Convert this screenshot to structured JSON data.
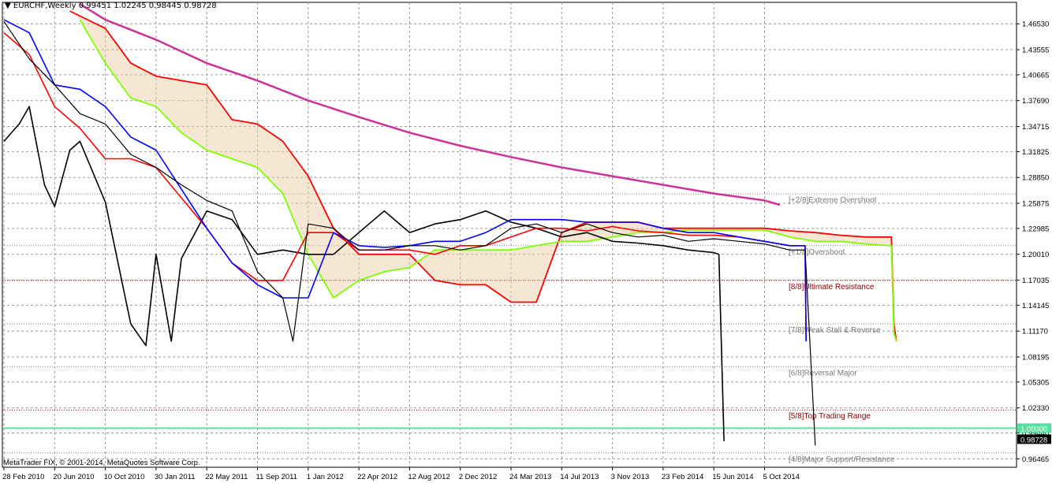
{
  "header": {
    "symbol": "EURCHF,Weekly",
    "ohlc": "0.99451 1.02245 0.98445 0.98728"
  },
  "footer": {
    "copyright": "MetaTrader FIX, © 2001-2014, MetaQuotes Software Corp."
  },
  "colors": {
    "background": "#ffffff",
    "grid": "#9a9a9a",
    "price": "#000000",
    "tenkan": "#0000ff",
    "kijun": "#ff0000",
    "chikou": "#000000",
    "senkou_b": "#ff0000",
    "senkou_a": "#7fff00",
    "long_ma": "#cc3399",
    "horizontal_line": "#55e0a0",
    "murrey_red": "#8b0000",
    "murrey_gray": "#7a7a7a"
  },
  "chart_data": {
    "type": "line",
    "instrument": "EURCHF",
    "timeframe": "Weekly",
    "ylim": [
      0.955,
      1.49
    ],
    "y_ticks": [
      "1.46530",
      "1.43555",
      "1.40665",
      "1.37690",
      "1.34715",
      "1.31825",
      "1.28850",
      "1.25875",
      "1.22985",
      "1.20010",
      "1.17035",
      "1.14145",
      "1.11170",
      "1.08195",
      "1.05305",
      "1.02330",
      "0.99440",
      "0.96465"
    ],
    "x_ticks": [
      "28 Feb 2010",
      "20 Jun 2010",
      "10 Oct 2010",
      "30 Jan 2011",
      "22 May 2011",
      "11 Sep 2011",
      "1 Jan 2012",
      "22 Apr 2012",
      "12 Aug 2012",
      "2 Dec 2012",
      "24 Mar 2013",
      "14 Jul 2013",
      "3 Nov 2013",
      "23 Feb 2014",
      "15 Jun 2014",
      "5 Oct 2014"
    ],
    "current_price_label": "0.98728",
    "horizontal_line_label": "1.00000",
    "murrey_levels": [
      {
        "label": "[+2/8]Extreme Overshoot",
        "value": 1.2695,
        "color": "gray"
      },
      {
        "label": "[+1/8]Overshoot",
        "value": 1.21,
        "color": "gray"
      },
      {
        "label": "[8/8]Ultimate Resistance",
        "value": 1.17,
        "color": "red"
      },
      {
        "label": "[7/8]Weak Stall & Reverse",
        "value": 1.12,
        "color": "gray"
      },
      {
        "label": "[6/8]Reversal Major",
        "value": 1.0705,
        "color": "gray"
      },
      {
        "label": "[5/8]Top Trading Range",
        "value": 1.021,
        "color": "red"
      },
      {
        "label": "[4/8]Major Support/Resistance",
        "value": 0.9715,
        "color": "gray"
      }
    ],
    "series": [
      {
        "key": "price",
        "x": [
          0,
          0.5,
          1,
          1.5,
          2,
          2.5,
          3,
          3.5,
          4,
          4.5,
          5,
          5.5,
          5.7,
          6,
          6.5,
          7,
          7.5,
          8,
          8.5,
          9,
          9.5,
          10,
          10.5,
          11,
          11.5,
          12,
          12.5,
          13,
          13.5,
          14,
          14.5,
          15,
          15.5,
          15.8,
          16
        ],
        "values": [
          1.468,
          1.425,
          1.395,
          1.362,
          1.35,
          1.315,
          1.3,
          1.28,
          1.262,
          1.25,
          1.18,
          1.15,
          1.1,
          1.235,
          1.23,
          1.205,
          1.205,
          1.21,
          1.21,
          1.205,
          1.21,
          1.23,
          1.235,
          1.225,
          1.235,
          1.225,
          1.22,
          1.222,
          1.215,
          1.218,
          1.215,
          1.212,
          1.205,
          1.205,
          0.98
        ]
      },
      {
        "key": "tenkan",
        "x": [
          0,
          0.5,
          1,
          1.5,
          2,
          2.5,
          3,
          3.5,
          4,
          4.5,
          5,
          5.5,
          6,
          6.5,
          7,
          7.5,
          8,
          8.5,
          9,
          9.5,
          10,
          10.5,
          11,
          11.5,
          12,
          12.5,
          13,
          13.5,
          14,
          14.5,
          15,
          15.5,
          15.8,
          15.82
        ],
        "values": [
          1.47,
          1.455,
          1.395,
          1.39,
          1.37,
          1.335,
          1.32,
          1.275,
          1.23,
          1.19,
          1.165,
          1.15,
          1.15,
          1.225,
          1.21,
          1.208,
          1.21,
          1.215,
          1.215,
          1.225,
          1.24,
          1.24,
          1.24,
          1.237,
          1.237,
          1.237,
          1.23,
          1.225,
          1.225,
          1.22,
          1.215,
          1.21,
          1.21,
          1.1
        ]
      },
      {
        "key": "kijun",
        "x": [
          0,
          0.5,
          1,
          1.5,
          2,
          2.5,
          3,
          3.5,
          4,
          4.5,
          5,
          5.5,
          6,
          6.5,
          7,
          7.5,
          8,
          8.5,
          9,
          9.5,
          10,
          10.5,
          11,
          11.5,
          12,
          12.5,
          13,
          13.5,
          14,
          14.5,
          15,
          15.5,
          15.8,
          15.82
        ],
        "values": [
          1.455,
          1.43,
          1.37,
          1.345,
          1.31,
          1.31,
          1.3,
          1.265,
          1.23,
          1.19,
          1.17,
          1.17,
          1.225,
          1.225,
          1.205,
          1.205,
          1.205,
          1.2,
          1.21,
          1.21,
          1.22,
          1.23,
          1.23,
          1.227,
          1.232,
          1.227,
          1.225,
          1.222,
          1.222,
          1.22,
          1.215,
          1.21,
          1.21,
          1.1
        ]
      },
      {
        "key": "chikou",
        "x": [
          0,
          0.3,
          0.5,
          0.8,
          1,
          1.3,
          1.5,
          2,
          2.5,
          2.8,
          3,
          3.3,
          3.5,
          4,
          4.5,
          5,
          5.5,
          6,
          6.5,
          7,
          7.5,
          8,
          8.5,
          9,
          9.5,
          10,
          10.5,
          11,
          11.5,
          12,
          12.5,
          13,
          13.5,
          14,
          14.1,
          14.2
        ],
        "values": [
          1.33,
          1.35,
          1.37,
          1.28,
          1.255,
          1.32,
          1.33,
          1.26,
          1.12,
          1.095,
          1.2,
          1.1,
          1.195,
          1.25,
          1.24,
          1.2,
          1.205,
          1.2,
          1.2,
          1.225,
          1.25,
          1.225,
          1.235,
          1.24,
          1.25,
          1.237,
          1.23,
          1.22,
          1.225,
          1.215,
          1.213,
          1.21,
          1.205,
          1.202,
          1.2,
          0.985
        ]
      },
      {
        "key": "senkou_b",
        "x": [
          1.3,
          2,
          2.5,
          3,
          3.5,
          4,
          4.5,
          5,
          5.5,
          6,
          6.5,
          7,
          7.5,
          8,
          8.5,
          9,
          9.5,
          10,
          10.5,
          11,
          11.5,
          12,
          12.5,
          13,
          13.5,
          14,
          14.5,
          15,
          15.5,
          16,
          16.5,
          17,
          17.5,
          17.55,
          17.6
        ],
        "values": [
          1.48,
          1.46,
          1.42,
          1.405,
          1.4,
          1.395,
          1.355,
          1.35,
          1.33,
          1.29,
          1.23,
          1.2,
          1.2,
          1.2,
          1.17,
          1.165,
          1.165,
          1.145,
          1.145,
          1.225,
          1.237,
          1.237,
          1.237,
          1.23,
          1.23,
          1.23,
          1.23,
          1.23,
          1.227,
          1.225,
          1.222,
          1.22,
          1.22,
          1.12,
          1.1
        ]
      },
      {
        "key": "senkou_a",
        "x": [
          1.5,
          2,
          2.5,
          3,
          3.5,
          4,
          4.5,
          5,
          5.5,
          6,
          6.5,
          7,
          7.5,
          8,
          8.5,
          9,
          9.5,
          10,
          10.5,
          11,
          11.5,
          12,
          12.5,
          13,
          13.5,
          14,
          14.5,
          15,
          15.5,
          16,
          16.5,
          17,
          17.5,
          17.55,
          17.6
        ],
        "values": [
          1.47,
          1.42,
          1.38,
          1.37,
          1.34,
          1.32,
          1.31,
          1.3,
          1.27,
          1.2,
          1.15,
          1.17,
          1.18,
          1.185,
          1.205,
          1.205,
          1.205,
          1.205,
          1.21,
          1.215,
          1.215,
          1.22,
          1.225,
          1.225,
          1.228,
          1.228,
          1.228,
          1.228,
          1.22,
          1.215,
          1.215,
          1.212,
          1.21,
          1.11,
          1.1
        ]
      },
      {
        "key": "long_ma",
        "x": [
          1.5,
          2,
          3,
          4,
          5,
          6,
          7,
          8,
          9,
          10,
          11,
          12,
          13,
          14,
          15,
          15.3
        ],
        "values": [
          1.488,
          1.47,
          1.447,
          1.42,
          1.4,
          1.377,
          1.358,
          1.34,
          1.325,
          1.312,
          1.3,
          1.29,
          1.28,
          1.27,
          1.262,
          1.257
        ]
      }
    ]
  }
}
